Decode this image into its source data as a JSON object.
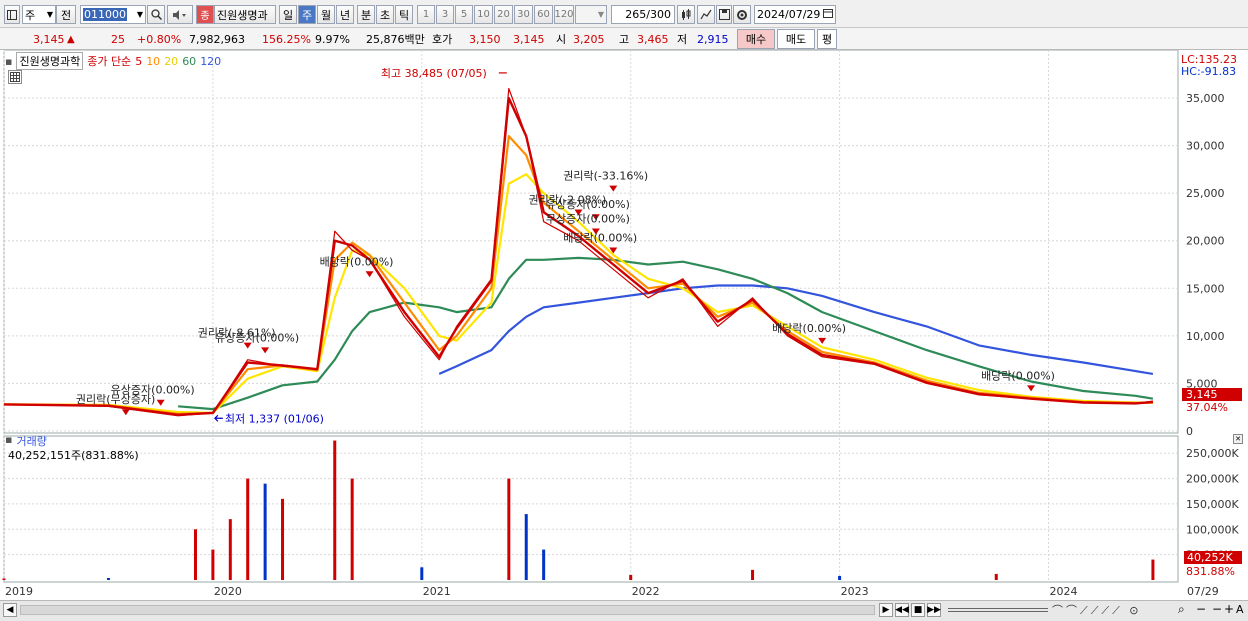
{
  "toolbar": {
    "period_type": "주",
    "mode": "전",
    "code": "011000",
    "name_button": "진원생명과",
    "name_badge": "종",
    "periods": [
      "일",
      "주",
      "월",
      "년",
      "분",
      "초",
      "틱"
    ],
    "active_period": "주",
    "tick_counts": [
      "1",
      "3",
      "5",
      "10",
      "20",
      "30",
      "60",
      "120"
    ],
    "count": "265",
    "count_total": "/300",
    "date": "2024/07/29"
  },
  "quote": {
    "price": "3,145",
    "change_arrow": "▲",
    "change": "25",
    "change_pct": "+0.80%",
    "volume": "7,982,963",
    "volume_ratio": "156.25%",
    "turnover_rate": "9.97%",
    "amount": "25,876백만",
    "bid_label": "호가",
    "bid1": "3,150",
    "bid2": "3,145",
    "open_label": "시",
    "open": "3,205",
    "high_label": "고",
    "high": "3,465",
    "low_label": "저",
    "low": "2,915",
    "buy_button": "매수",
    "sell_button": "매도",
    "eval_button": "평"
  },
  "colors": {
    "up": "#d00000",
    "down": "#0033c8",
    "ma5": "#d00000",
    "ma10": "#ff8c00",
    "ma20": "#ffe600",
    "ma60": "#2e8b57",
    "ma120": "#3355dd"
  },
  "chart_data": [
    {
      "type": "line",
      "title": "진원생명과학",
      "legend": {
        "prefix": "종가 단순",
        "periods": [
          "5",
          "10",
          "20",
          "60",
          "120"
        ]
      },
      "corner_labels": {
        "lc": "LC:135.23",
        "hc": "HC:-91.83"
      },
      "last_price_tag": "3,145",
      "last_pct_tag": "37.04%",
      "ylim": [
        0,
        39000
      ],
      "yticks": [
        0,
        5000,
        10000,
        15000,
        20000,
        25000,
        30000,
        35000
      ],
      "ytick_labels": [
        "0",
        "5,000",
        "10,000",
        "15,000",
        "20,000",
        "25,000",
        "30,000",
        "35,000"
      ],
      "xlabels": [
        "2019",
        "2020",
        "2021",
        "2022",
        "2023",
        "2024",
        "07/29"
      ],
      "x": [
        "2019-01",
        "2019-07",
        "2019-11",
        "2020-01",
        "2020-03",
        "2020-05",
        "2020-07",
        "2020-08",
        "2020-09",
        "2020-10",
        "2020-12",
        "2021-02",
        "2021-03",
        "2021-05",
        "2021-06",
        "2021-07",
        "2021-08",
        "2021-10",
        "2021-12",
        "2022-02",
        "2022-04",
        "2022-06",
        "2022-08",
        "2022-10",
        "2022-12",
        "2023-03",
        "2023-06",
        "2023-09",
        "2023-12",
        "2024-03",
        "2024-06",
        "2024-07"
      ],
      "series": [
        {
          "name": "종가",
          "values": [
            2800,
            2600,
            1600,
            1900,
            7500,
            6800,
            6500,
            21000,
            19000,
            18000,
            12000,
            7500,
            11000,
            16000,
            36000,
            31000,
            22000,
            20000,
            17000,
            14000,
            16000,
            11000,
            14000,
            10000,
            7800,
            7000,
            5000,
            3800,
            3400,
            3000,
            2900,
            3145
          ]
        },
        {
          "name": "5",
          "values": [
            2800,
            2650,
            1700,
            1900,
            7200,
            6900,
            6500,
            20000,
            19500,
            18000,
            12500,
            7800,
            10800,
            15800,
            35000,
            31000,
            23000,
            20500,
            17500,
            14500,
            15800,
            11500,
            13800,
            10200,
            8000,
            7100,
            5100,
            3900,
            3400,
            3000,
            2900,
            3050
          ]
        },
        {
          "name": "10",
          "values": [
            2800,
            2700,
            1800,
            1900,
            6500,
            6900,
            6400,
            18000,
            19800,
            18500,
            13500,
            8500,
            10000,
            15000,
            31000,
            29000,
            24000,
            21000,
            18000,
            15000,
            15500,
            12000,
            13500,
            10500,
            8300,
            7200,
            5300,
            4000,
            3500,
            3050,
            2950,
            3000
          ]
        },
        {
          "name": "20",
          "values": [
            2800,
            2750,
            2000,
            1900,
            5500,
            6800,
            6300,
            14000,
            19000,
            18500,
            15000,
            10000,
            9500,
            13500,
            26000,
            27000,
            25000,
            22000,
            18500,
            16000,
            15000,
            12500,
            13200,
            11000,
            8800,
            7500,
            5600,
            4300,
            3600,
            3150,
            3000,
            2950
          ]
        },
        {
          "name": "60",
          "values": [
            null,
            null,
            2600,
            2300,
            3500,
            4800,
            5200,
            7500,
            10500,
            12500,
            13500,
            13000,
            12500,
            13000,
            16000,
            18000,
            18000,
            18200,
            18000,
            17500,
            17800,
            17000,
            16000,
            14500,
            12500,
            10500,
            8500,
            6800,
            5200,
            4200,
            3700,
            3400
          ]
        },
        {
          "name": "120",
          "values": [
            null,
            null,
            null,
            null,
            null,
            null,
            null,
            null,
            null,
            null,
            null,
            6000,
            6800,
            8500,
            10500,
            12000,
            13000,
            13500,
            14000,
            14500,
            15000,
            15300,
            15300,
            15000,
            14200,
            12500,
            11000,
            9000,
            8000,
            7200,
            6300,
            6000
          ]
        }
      ],
      "annotations": [
        {
          "label": "최고 38,485 (07/05)",
          "x": "2021-06",
          "y": 38485
        },
        {
          "label": "최저 1,337 (01/06)",
          "x": "2020-01",
          "y": 1337
        },
        {
          "label": "권리락(-33.16%)",
          "x": "2021-12",
          "y": 26000
        },
        {
          "label": "권리락(-2.08%)",
          "x": "2021-10",
          "y": 23500
        },
        {
          "label": "유상증자(0.00%)",
          "x": "2021-11",
          "y": 23000
        },
        {
          "label": "무상증자(0.00%)",
          "x": "2021-11",
          "y": 21500
        },
        {
          "label": "배당락(0.00%)",
          "x": "2021-12",
          "y": 19500
        },
        {
          "label": "배당락(0.00%)",
          "x": "2020-10",
          "y": 17000
        },
        {
          "label": "권리락(-8.61%)",
          "x": "2020-03",
          "y": 9500
        },
        {
          "label": "유상증자(0.00%)",
          "x": "2020-04",
          "y": 9000
        },
        {
          "label": "유상증자(0.00%)",
          "x": "2019-10",
          "y": 3500
        },
        {
          "label": "권리락(무상증자)",
          "x": "2019-08",
          "y": 2500
        },
        {
          "label": "배당락(0.00%)",
          "x": "2022-12",
          "y": 10000
        },
        {
          "label": "배당락(0.00%)",
          "x": "2023-12",
          "y": 5000
        }
      ]
    },
    {
      "type": "bar",
      "title": "거래량",
      "subtitle": "40,252,151주(831.88%)",
      "last_value_tag": "40,252K",
      "last_pct_tag": "831.88%",
      "ylim": [
        0,
        280000
      ],
      "yticks": [
        50000,
        100000,
        150000,
        200000,
        250000
      ],
      "ytick_labels": [
        "50,000K",
        "100,000K",
        "150,000K",
        "200,000K",
        "250,000K"
      ],
      "x": [
        "2019-01",
        "2019-07",
        "2019-12",
        "2020-01",
        "2020-02",
        "2020-03",
        "2020-04",
        "2020-05",
        "2020-08",
        "2020-09",
        "2021-01",
        "2021-06",
        "2021-07",
        "2021-08",
        "2022-01",
        "2022-08",
        "2023-01",
        "2023-10",
        "2024-07"
      ],
      "values": [
        3000,
        4000,
        100000,
        60000,
        120000,
        200000,
        190000,
        160000,
        275000,
        200000,
        25000,
        200000,
        130000,
        60000,
        10000,
        20000,
        8000,
        12000,
        40252
      ]
    }
  ],
  "bottom": {
    "zoom_label": "A"
  }
}
